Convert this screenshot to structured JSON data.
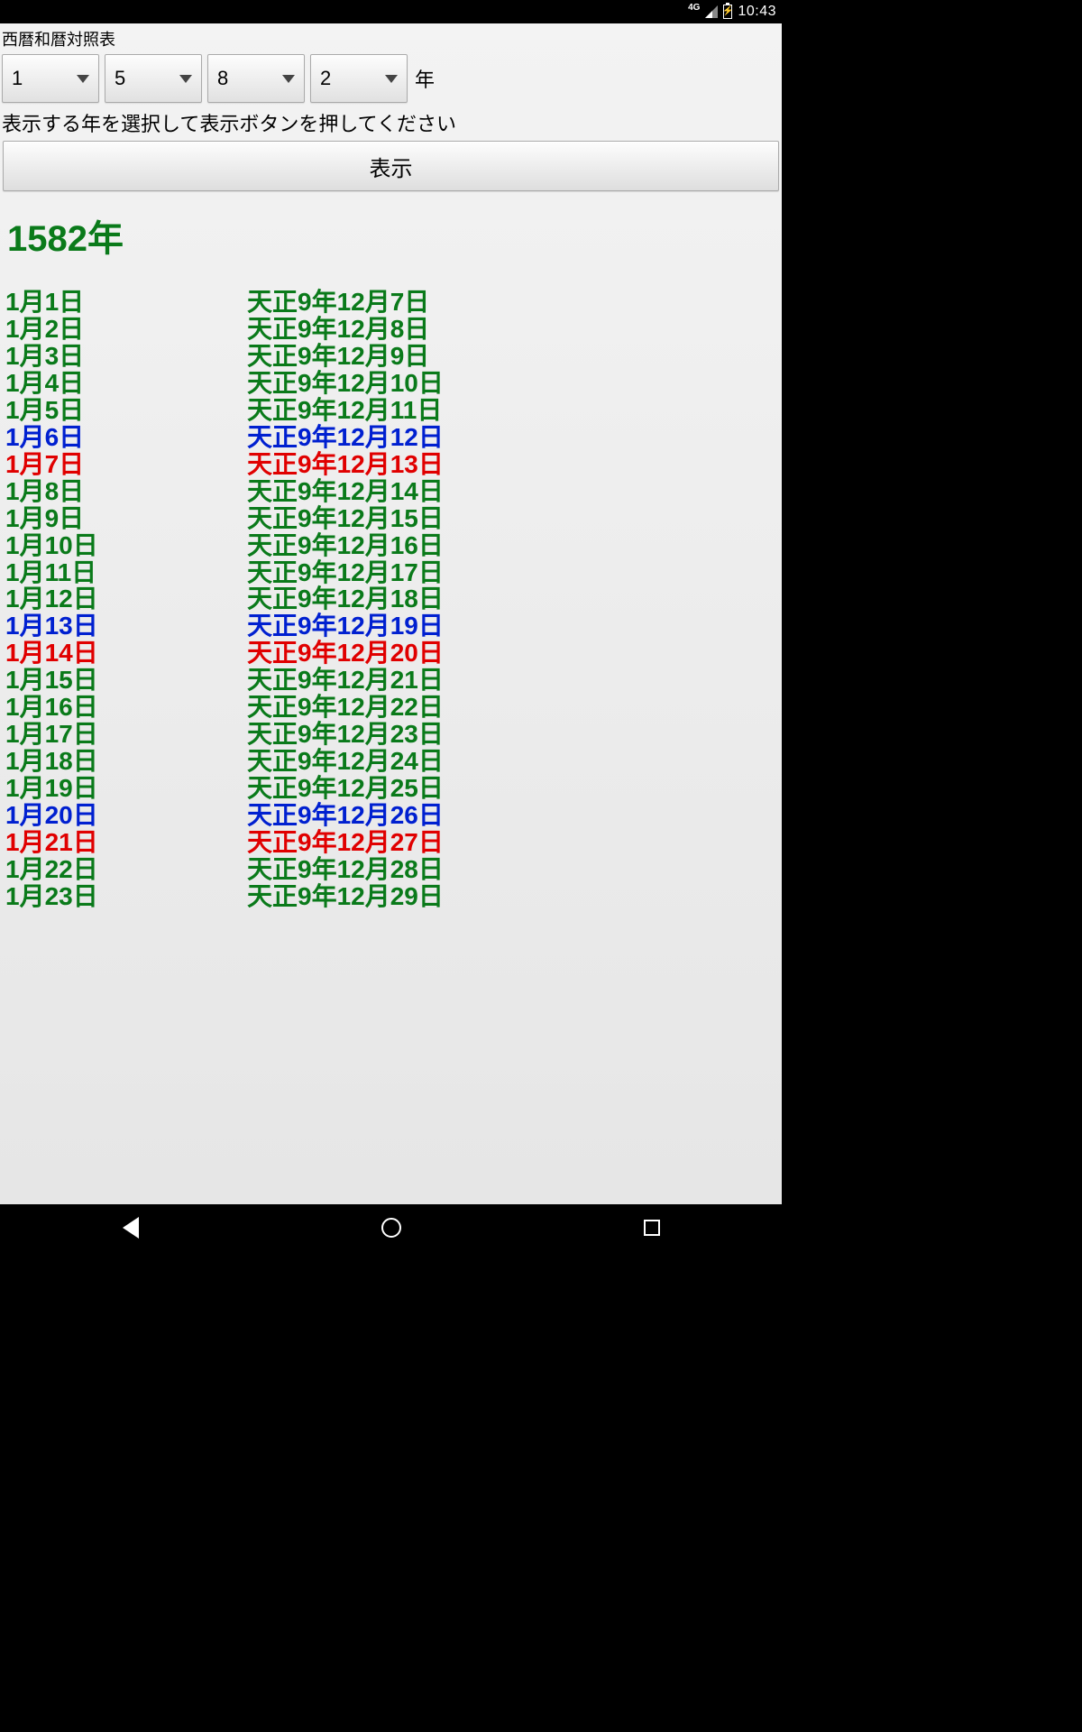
{
  "status": {
    "network": "4G",
    "time": "10:43"
  },
  "app_title": "西暦和暦対照表",
  "pickers": {
    "d1": "1",
    "d2": "5",
    "d3": "8",
    "d4": "2",
    "suffix": "年"
  },
  "hint": "表示する年を選択して表示ボタンを押してください",
  "show_button": "表示",
  "year_heading": "1582年",
  "rows": [
    {
      "greg": "1月1日",
      "jp": "天正9年12月7日",
      "color": "green"
    },
    {
      "greg": "1月2日",
      "jp": "天正9年12月8日",
      "color": "green"
    },
    {
      "greg": "1月3日",
      "jp": "天正9年12月9日",
      "color": "green"
    },
    {
      "greg": "1月4日",
      "jp": "天正9年12月10日",
      "color": "green"
    },
    {
      "greg": "1月5日",
      "jp": "天正9年12月11日",
      "color": "green"
    },
    {
      "greg": "1月6日",
      "jp": "天正9年12月12日",
      "color": "blue"
    },
    {
      "greg": "1月7日",
      "jp": "天正9年12月13日",
      "color": "red"
    },
    {
      "greg": "1月8日",
      "jp": "天正9年12月14日",
      "color": "green"
    },
    {
      "greg": "1月9日",
      "jp": "天正9年12月15日",
      "color": "green"
    },
    {
      "greg": "1月10日",
      "jp": "天正9年12月16日",
      "color": "green"
    },
    {
      "greg": "1月11日",
      "jp": "天正9年12月17日",
      "color": "green"
    },
    {
      "greg": "1月12日",
      "jp": "天正9年12月18日",
      "color": "green"
    },
    {
      "greg": "1月13日",
      "jp": "天正9年12月19日",
      "color": "blue"
    },
    {
      "greg": "1月14日",
      "jp": "天正9年12月20日",
      "color": "red"
    },
    {
      "greg": "1月15日",
      "jp": "天正9年12月21日",
      "color": "green"
    },
    {
      "greg": "1月16日",
      "jp": "天正9年12月22日",
      "color": "green"
    },
    {
      "greg": "1月17日",
      "jp": "天正9年12月23日",
      "color": "green"
    },
    {
      "greg": "1月18日",
      "jp": "天正9年12月24日",
      "color": "green"
    },
    {
      "greg": "1月19日",
      "jp": "天正9年12月25日",
      "color": "green"
    },
    {
      "greg": "1月20日",
      "jp": "天正9年12月26日",
      "color": "blue"
    },
    {
      "greg": "1月21日",
      "jp": "天正9年12月27日",
      "color": "red"
    },
    {
      "greg": "1月22日",
      "jp": "天正9年12月28日",
      "color": "green"
    },
    {
      "greg": "1月23日",
      "jp": "天正9年12月29日",
      "color": "green"
    }
  ]
}
